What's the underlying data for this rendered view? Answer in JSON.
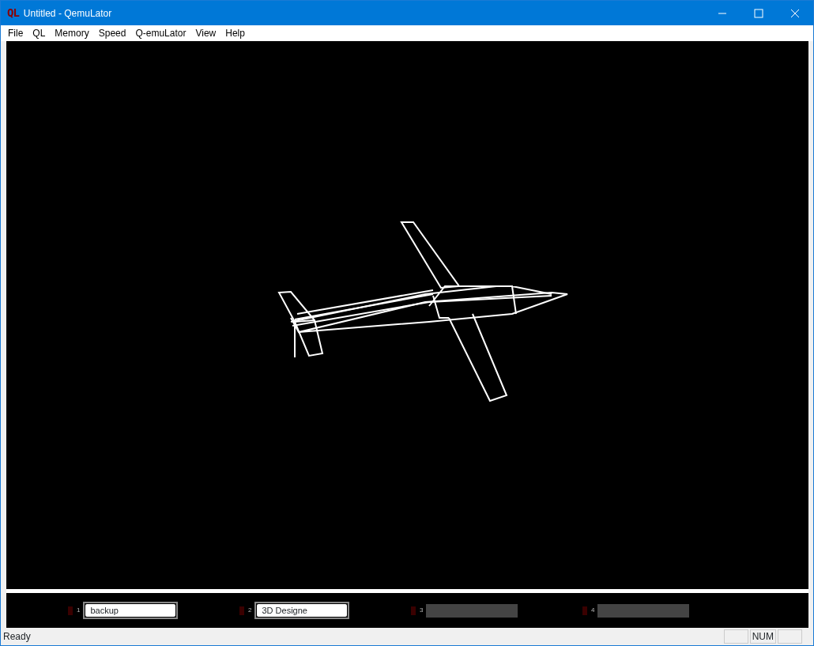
{
  "window": {
    "title": "Untitled - QemuLator",
    "logo": "QL"
  },
  "menu": [
    "File",
    "QL",
    "Memory",
    "Speed",
    "Q-emuLator",
    "View",
    "Help"
  ],
  "drives": [
    {
      "number": "1",
      "kind": "named",
      "value": "backup"
    },
    {
      "number": "2",
      "kind": "named",
      "value": "3D Designe"
    },
    {
      "number": "3",
      "kind": "empty"
    },
    {
      "number": "4",
      "kind": "empty"
    }
  ],
  "status_bar": {
    "text": "Ready",
    "indicator": "NUM"
  }
}
